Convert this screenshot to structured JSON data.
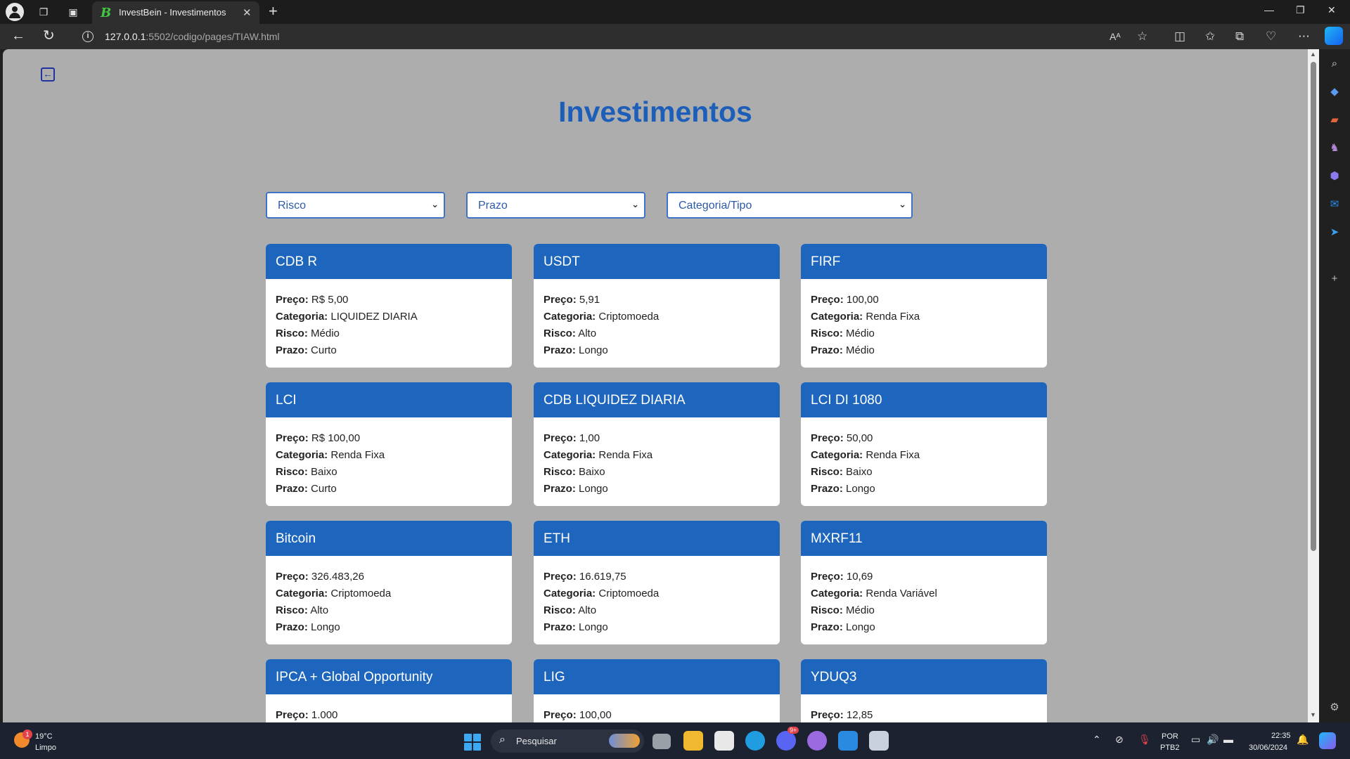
{
  "browser": {
    "tab_title": "InvestBein - Investimentos",
    "tab_favicon": "B",
    "url_host": "127.0.0.1",
    "url_path": ":5502/codigo/pages/TIAW.html"
  },
  "page": {
    "title": "Investimentos",
    "back_icon": "arrow-left-icon",
    "filters": {
      "risco": "Risco",
      "prazo": "Prazo",
      "categoria": "Categoria/Tipo"
    },
    "labels": {
      "preco": "Preço:",
      "categoria": "Categoria:",
      "risco": "Risco:",
      "prazo": "Prazo:"
    },
    "cards": [
      {
        "name": "CDB R",
        "preco": "R$ 5,00",
        "categoria": "LIQUIDEZ DIARIA",
        "risco": "Médio",
        "prazo": "Curto"
      },
      {
        "name": "USDT",
        "preco": "5,91",
        "categoria": "Criptomoeda",
        "risco": "Alto",
        "prazo": "Longo"
      },
      {
        "name": "FIRF",
        "preco": "100,00",
        "categoria": "Renda Fixa",
        "risco": "Médio",
        "prazo": "Médio"
      },
      {
        "name": "LCI",
        "preco": "R$ 100,00",
        "categoria": "Renda Fixa",
        "risco": "Baixo",
        "prazo": "Curto"
      },
      {
        "name": "CDB LIQUIDEZ DIARIA",
        "preco": "1,00",
        "categoria": "Renda Fixa",
        "risco": "Baixo",
        "prazo": "Longo"
      },
      {
        "name": "LCI DI 1080",
        "preco": "50,00",
        "categoria": "Renda Fixa",
        "risco": "Baixo",
        "prazo": "Longo"
      },
      {
        "name": "Bitcoin",
        "preco": "326.483,26",
        "categoria": "Criptomoeda",
        "risco": "Alto",
        "prazo": "Longo"
      },
      {
        "name": "ETH",
        "preco": "16.619,75",
        "categoria": "Criptomoeda",
        "risco": "Alto",
        "prazo": "Longo"
      },
      {
        "name": "MXRF11",
        "preco": "10,69",
        "categoria": "Renda Variável",
        "risco": "Médio",
        "prazo": "Longo"
      },
      {
        "name": "IPCA + Global Opportunity",
        "preco": "1.000",
        "categoria": "",
        "risco": "",
        "prazo": ""
      },
      {
        "name": "LIG",
        "preco": "100,00",
        "categoria": "",
        "risco": "",
        "prazo": ""
      },
      {
        "name": "YDUQ3",
        "preco": "12,85",
        "categoria": "",
        "risco": "",
        "prazo": ""
      }
    ]
  },
  "taskbar": {
    "weather_temp": "19°C",
    "weather_desc": "Limpo",
    "weather_badge": "1",
    "search_placeholder": "Pesquisar",
    "discord_badge": "9+",
    "lang_top": "POR",
    "lang_bottom": "PTB2",
    "time": "22:35",
    "date": "30/06/2024"
  },
  "colors": {
    "page_bg": "#adadad",
    "card_header": "#1e66bd",
    "title": "#1d5fb8"
  }
}
